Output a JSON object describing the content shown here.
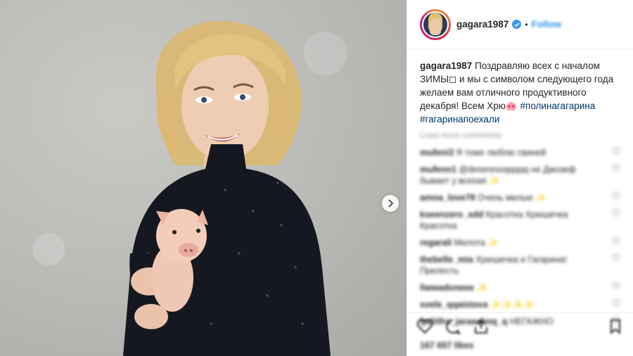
{
  "post": {
    "username": "gagara1987",
    "follow_label": "Follow",
    "separator": "•",
    "caption": {
      "user": "gagara1987",
      "text": "Поздравляю всех с началом ЗИМЫ◻ и мы с символом следующего года желаем вам отличного продуктивного декабря! Всем Хрю🐽",
      "hashtags": "#полинагагарина #гагаринапоехали"
    },
    "load_more_label": "Load more comments",
    "comments": [
      {
        "user": "mufeni3",
        "text": "Я тоже люблю свиней"
      },
      {
        "user": "mufenn1",
        "text": "@deserevoqqqqq не Джозеф бывает у всехая ✨"
      },
      {
        "user": "amna_love78",
        "text": "Очень милые ✨"
      },
      {
        "user": "kseenzero_xdd",
        "text": "Красотка Хрюшечка Красотка"
      },
      {
        "user": "regarali",
        "text": "Милота ✨"
      },
      {
        "user": "thebelle_mia",
        "text": "Хрюшечка и Гагарина! Прелесть"
      },
      {
        "user": "liwwadoneee",
        "text": "✨"
      },
      {
        "user": "svele_qqaistova",
        "text": "✨✨✨✨"
      },
      {
        "user": "ljaltiths_jaraaabnq_q",
        "text": "НЕГАЖНО"
      }
    ],
    "likes_text": "167 657 likes",
    "accent_color": "#3897f0"
  },
  "icons": {
    "next": "chevron-right-icon",
    "verified": "verified-badge-icon",
    "like": "heart-icon",
    "comment": "comment-icon",
    "share": "share-icon",
    "save": "bookmark-icon"
  }
}
